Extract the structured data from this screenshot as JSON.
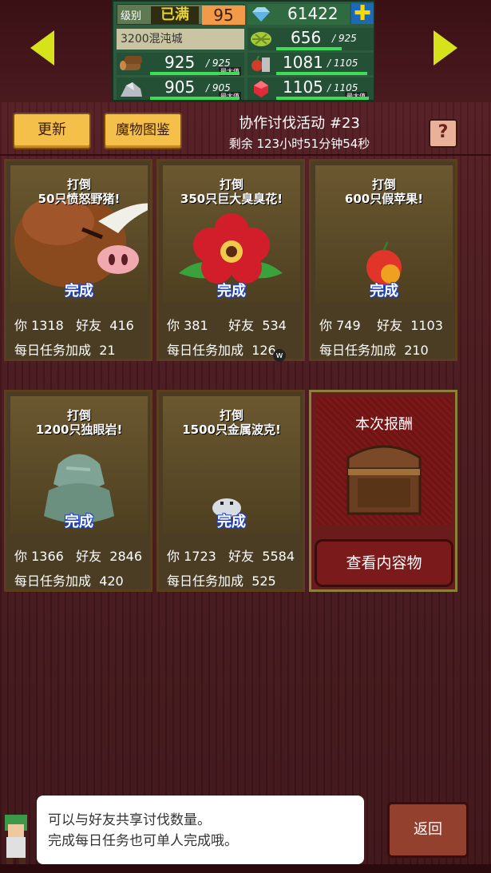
{
  "header": {
    "level_label": "级别",
    "level_badge": "已满",
    "level_value": "95",
    "town_name": "3200混沌城",
    "gems": "61422",
    "resources": [
      {
        "icon": "wood-icon",
        "value": "925",
        "max": "925",
        "tag": "最大值"
      },
      {
        "icon": "ore-icon",
        "value": "905",
        "max": "905",
        "tag": "最大值"
      },
      {
        "icon": "grass-icon",
        "value": "656",
        "max": "925",
        "tag": ""
      },
      {
        "icon": "food-icon",
        "value": "1081",
        "max": "1105",
        "tag": ""
      },
      {
        "icon": "ruby-icon",
        "value": "1105",
        "max": "1105",
        "tag": "最大值"
      }
    ],
    "resource_fill": [
      1.0,
      1.0,
      0.71,
      0.98,
      1.0
    ]
  },
  "toolbar": {
    "refresh_label": "更新",
    "bestiary_label": "魔物图鉴",
    "event_title": "协作讨伐活动 #23",
    "event_timer": "剩余 123小时51分钟54秒",
    "help_label": "?"
  },
  "cards": [
    {
      "goal_line1": "打倒",
      "goal_line2": "50只愤怒野猪!",
      "status": "完成",
      "you_label": "你",
      "you": "1318",
      "friend_label": "好友",
      "friend": "416",
      "daily_label": "每日任务加成",
      "daily": "21",
      "monster": "boar"
    },
    {
      "goal_line1": "打倒",
      "goal_line2": "350只巨大臭臭花!",
      "status": "完成",
      "you_label": "你",
      "you": "381",
      "friend_label": "好友",
      "friend": "534",
      "daily_label": "每日任务加成",
      "daily": "126",
      "monster": "flower"
    },
    {
      "goal_line1": "打倒",
      "goal_line2": "600只假苹果!",
      "status": "完成",
      "you_label": "你",
      "you": "749",
      "friend_label": "好友",
      "friend": "1103",
      "daily_label": "每日任务加成",
      "daily": "210",
      "monster": "apple"
    },
    {
      "goal_line1": "打倒",
      "goal_line2": "1200只独眼岩!",
      "status": "完成",
      "you_label": "你",
      "you": "1366",
      "friend_label": "好友",
      "friend": "2846",
      "daily_label": "每日任务加成",
      "daily": "420",
      "monster": "rock"
    },
    {
      "goal_line1": "打倒",
      "goal_line2": "1500只金属波克!",
      "status": "完成",
      "you_label": "你",
      "you": "1723",
      "friend_label": "好友",
      "friend": "5584",
      "daily_label": "每日任务加成",
      "daily": "525",
      "monster": "slime"
    }
  ],
  "reward": {
    "title": "本次报酬",
    "view_label": "查看内容物"
  },
  "footer": {
    "message_line1": "可以与好友共享讨伐数量。",
    "message_line2": "完成每日任务也可单人完成哦。",
    "back_label": "返回"
  },
  "cursor_mark": "w"
}
